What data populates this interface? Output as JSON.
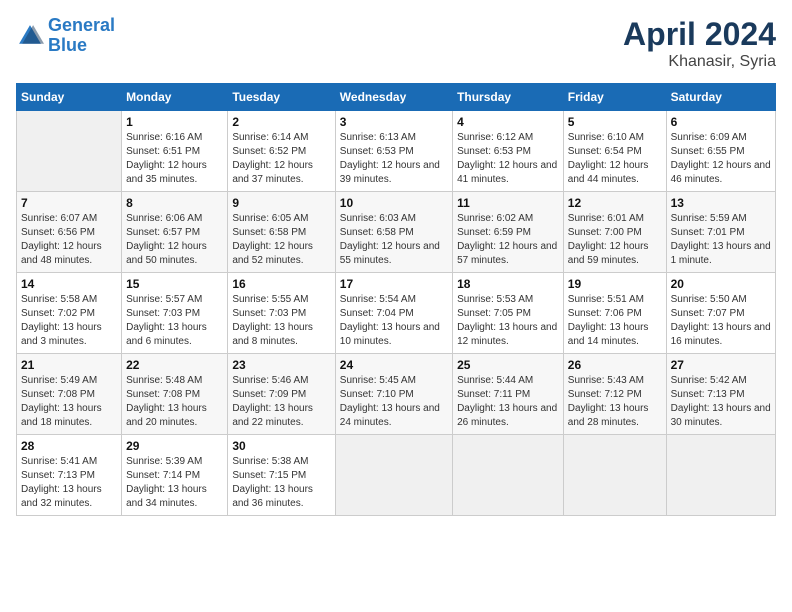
{
  "logo": {
    "line1": "General",
    "line2": "Blue"
  },
  "title": "April 2024",
  "subtitle": "Khanasir, Syria",
  "days_header": [
    "Sunday",
    "Monday",
    "Tuesday",
    "Wednesday",
    "Thursday",
    "Friday",
    "Saturday"
  ],
  "weeks": [
    [
      {
        "num": "",
        "sunrise": "",
        "sunset": "",
        "daylight": ""
      },
      {
        "num": "1",
        "sunrise": "Sunrise: 6:16 AM",
        "sunset": "Sunset: 6:51 PM",
        "daylight": "Daylight: 12 hours and 35 minutes."
      },
      {
        "num": "2",
        "sunrise": "Sunrise: 6:14 AM",
        "sunset": "Sunset: 6:52 PM",
        "daylight": "Daylight: 12 hours and 37 minutes."
      },
      {
        "num": "3",
        "sunrise": "Sunrise: 6:13 AM",
        "sunset": "Sunset: 6:53 PM",
        "daylight": "Daylight: 12 hours and 39 minutes."
      },
      {
        "num": "4",
        "sunrise": "Sunrise: 6:12 AM",
        "sunset": "Sunset: 6:53 PM",
        "daylight": "Daylight: 12 hours and 41 minutes."
      },
      {
        "num": "5",
        "sunrise": "Sunrise: 6:10 AM",
        "sunset": "Sunset: 6:54 PM",
        "daylight": "Daylight: 12 hours and 44 minutes."
      },
      {
        "num": "6",
        "sunrise": "Sunrise: 6:09 AM",
        "sunset": "Sunset: 6:55 PM",
        "daylight": "Daylight: 12 hours and 46 minutes."
      }
    ],
    [
      {
        "num": "7",
        "sunrise": "Sunrise: 6:07 AM",
        "sunset": "Sunset: 6:56 PM",
        "daylight": "Daylight: 12 hours and 48 minutes."
      },
      {
        "num": "8",
        "sunrise": "Sunrise: 6:06 AM",
        "sunset": "Sunset: 6:57 PM",
        "daylight": "Daylight: 12 hours and 50 minutes."
      },
      {
        "num": "9",
        "sunrise": "Sunrise: 6:05 AM",
        "sunset": "Sunset: 6:58 PM",
        "daylight": "Daylight: 12 hours and 52 minutes."
      },
      {
        "num": "10",
        "sunrise": "Sunrise: 6:03 AM",
        "sunset": "Sunset: 6:58 PM",
        "daylight": "Daylight: 12 hours and 55 minutes."
      },
      {
        "num": "11",
        "sunrise": "Sunrise: 6:02 AM",
        "sunset": "Sunset: 6:59 PM",
        "daylight": "Daylight: 12 hours and 57 minutes."
      },
      {
        "num": "12",
        "sunrise": "Sunrise: 6:01 AM",
        "sunset": "Sunset: 7:00 PM",
        "daylight": "Daylight: 12 hours and 59 minutes."
      },
      {
        "num": "13",
        "sunrise": "Sunrise: 5:59 AM",
        "sunset": "Sunset: 7:01 PM",
        "daylight": "Daylight: 13 hours and 1 minute."
      }
    ],
    [
      {
        "num": "14",
        "sunrise": "Sunrise: 5:58 AM",
        "sunset": "Sunset: 7:02 PM",
        "daylight": "Daylight: 13 hours and 3 minutes."
      },
      {
        "num": "15",
        "sunrise": "Sunrise: 5:57 AM",
        "sunset": "Sunset: 7:03 PM",
        "daylight": "Daylight: 13 hours and 6 minutes."
      },
      {
        "num": "16",
        "sunrise": "Sunrise: 5:55 AM",
        "sunset": "Sunset: 7:03 PM",
        "daylight": "Daylight: 13 hours and 8 minutes."
      },
      {
        "num": "17",
        "sunrise": "Sunrise: 5:54 AM",
        "sunset": "Sunset: 7:04 PM",
        "daylight": "Daylight: 13 hours and 10 minutes."
      },
      {
        "num": "18",
        "sunrise": "Sunrise: 5:53 AM",
        "sunset": "Sunset: 7:05 PM",
        "daylight": "Daylight: 13 hours and 12 minutes."
      },
      {
        "num": "19",
        "sunrise": "Sunrise: 5:51 AM",
        "sunset": "Sunset: 7:06 PM",
        "daylight": "Daylight: 13 hours and 14 minutes."
      },
      {
        "num": "20",
        "sunrise": "Sunrise: 5:50 AM",
        "sunset": "Sunset: 7:07 PM",
        "daylight": "Daylight: 13 hours and 16 minutes."
      }
    ],
    [
      {
        "num": "21",
        "sunrise": "Sunrise: 5:49 AM",
        "sunset": "Sunset: 7:08 PM",
        "daylight": "Daylight: 13 hours and 18 minutes."
      },
      {
        "num": "22",
        "sunrise": "Sunrise: 5:48 AM",
        "sunset": "Sunset: 7:08 PM",
        "daylight": "Daylight: 13 hours and 20 minutes."
      },
      {
        "num": "23",
        "sunrise": "Sunrise: 5:46 AM",
        "sunset": "Sunset: 7:09 PM",
        "daylight": "Daylight: 13 hours and 22 minutes."
      },
      {
        "num": "24",
        "sunrise": "Sunrise: 5:45 AM",
        "sunset": "Sunset: 7:10 PM",
        "daylight": "Daylight: 13 hours and 24 minutes."
      },
      {
        "num": "25",
        "sunrise": "Sunrise: 5:44 AM",
        "sunset": "Sunset: 7:11 PM",
        "daylight": "Daylight: 13 hours and 26 minutes."
      },
      {
        "num": "26",
        "sunrise": "Sunrise: 5:43 AM",
        "sunset": "Sunset: 7:12 PM",
        "daylight": "Daylight: 13 hours and 28 minutes."
      },
      {
        "num": "27",
        "sunrise": "Sunrise: 5:42 AM",
        "sunset": "Sunset: 7:13 PM",
        "daylight": "Daylight: 13 hours and 30 minutes."
      }
    ],
    [
      {
        "num": "28",
        "sunrise": "Sunrise: 5:41 AM",
        "sunset": "Sunset: 7:13 PM",
        "daylight": "Daylight: 13 hours and 32 minutes."
      },
      {
        "num": "29",
        "sunrise": "Sunrise: 5:39 AM",
        "sunset": "Sunset: 7:14 PM",
        "daylight": "Daylight: 13 hours and 34 minutes."
      },
      {
        "num": "30",
        "sunrise": "Sunrise: 5:38 AM",
        "sunset": "Sunset: 7:15 PM",
        "daylight": "Daylight: 13 hours and 36 minutes."
      },
      {
        "num": "",
        "sunrise": "",
        "sunset": "",
        "daylight": ""
      },
      {
        "num": "",
        "sunrise": "",
        "sunset": "",
        "daylight": ""
      },
      {
        "num": "",
        "sunrise": "",
        "sunset": "",
        "daylight": ""
      },
      {
        "num": "",
        "sunrise": "",
        "sunset": "",
        "daylight": ""
      }
    ]
  ]
}
